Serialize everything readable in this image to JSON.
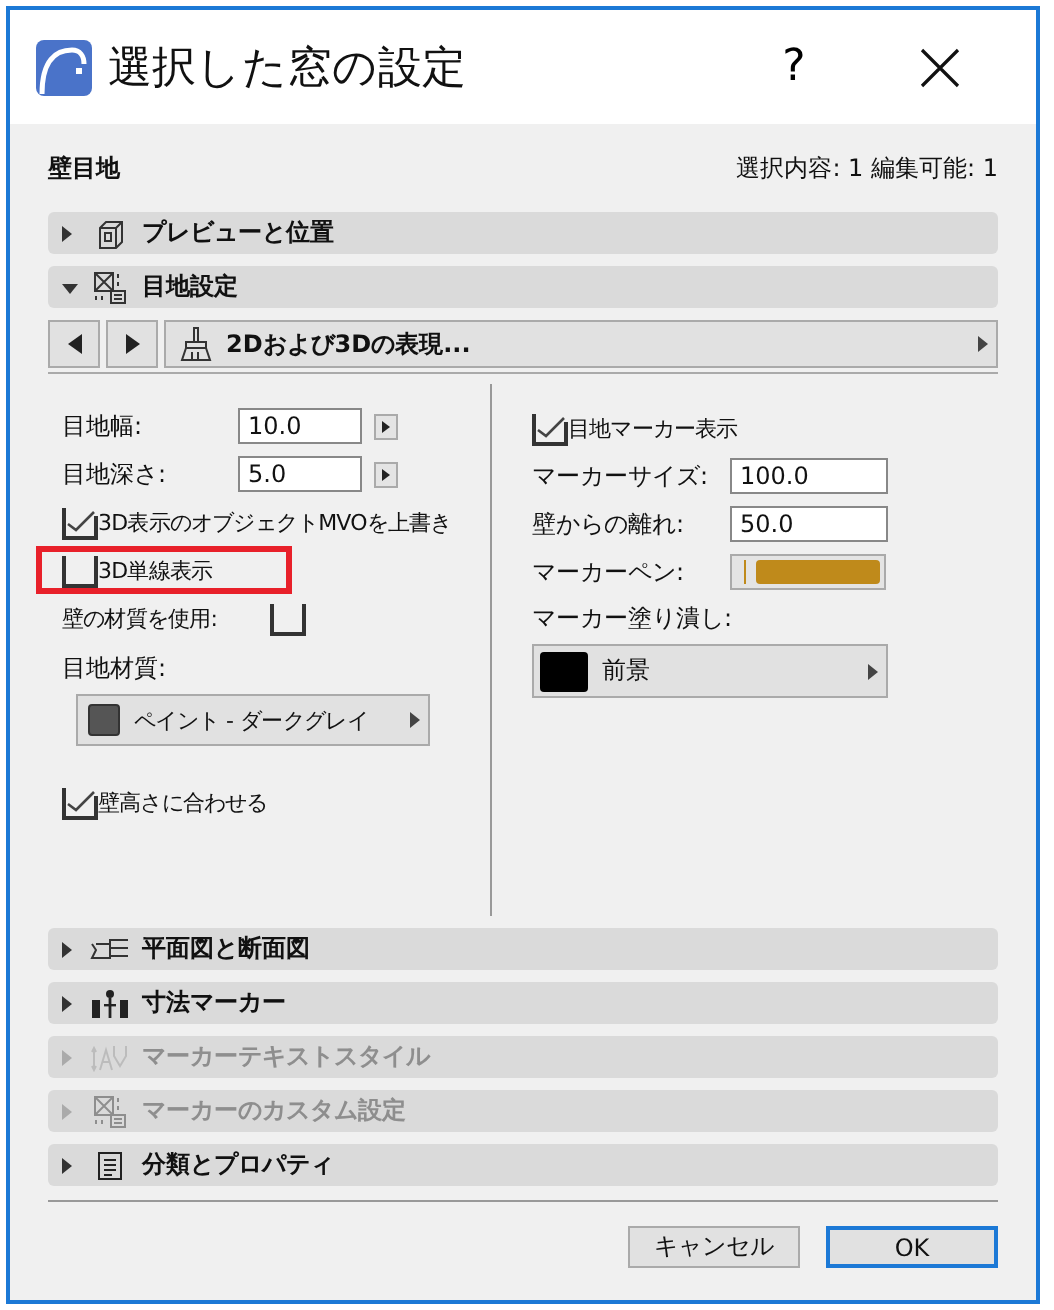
{
  "window": {
    "title": "選択した窓の設定",
    "help": "?"
  },
  "header": {
    "element_type": "壁目地",
    "selection_info": "選択内容: 1 編集可能: 1"
  },
  "sections_top": [
    {
      "label": "プレビューと位置",
      "kind": "preview",
      "expanded": false,
      "disabled": false
    },
    {
      "label": "目地設定",
      "kind": "joint",
      "expanded": true,
      "disabled": false
    }
  ],
  "page_nav": {
    "page": "2Dおよび3Dの表現..."
  },
  "left": {
    "fields": [
      {
        "label": "目地幅:",
        "value": "10.0"
      },
      {
        "label": "目地深さ:",
        "value": "5.0"
      }
    ],
    "checks": [
      {
        "label": "3D表示のオブジェクトMVOを上書き",
        "checked": true,
        "highlighted": false
      },
      {
        "label": "3D単線表示",
        "checked": false,
        "highlighted": true
      }
    ],
    "wall_material": {
      "label": "壁の材質を使用:",
      "checked": false
    },
    "material": {
      "label": "目地材質:",
      "value": "ペイント - ダークグレイ",
      "color": "#555555"
    },
    "fit_height": {
      "label": "壁高さに合わせる",
      "checked": true
    }
  },
  "right": {
    "show_marker": {
      "label": "目地マーカー表示",
      "checked": true
    },
    "fields": [
      {
        "label": "マーカーサイズ:",
        "value": "100.0"
      },
      {
        "label": "壁からの離れ:",
        "value": "50.0"
      }
    ],
    "pen": {
      "label": "マーカーペン:",
      "color": "#bf8a1b"
    },
    "fill": {
      "label": "マーカー塗り潰し:",
      "value": "前景",
      "color": "#000000"
    }
  },
  "sections_bottom": [
    {
      "label": "平面図と断面図",
      "kind": "plan",
      "expanded": false,
      "disabled": false
    },
    {
      "label": "寸法マーカー",
      "kind": "dimension",
      "expanded": false,
      "disabled": false
    },
    {
      "label": "マーカーテキストスタイル",
      "kind": "text-style",
      "expanded": false,
      "disabled": true
    },
    {
      "label": "マーカーのカスタム設定",
      "kind": "joint",
      "expanded": false,
      "disabled": true
    },
    {
      "label": "分類とプロパティ",
      "kind": "list",
      "expanded": false,
      "disabled": false
    }
  ],
  "buttons": [
    {
      "label": "キャンセル",
      "default": false
    },
    {
      "label": "OK",
      "default": true
    }
  ]
}
